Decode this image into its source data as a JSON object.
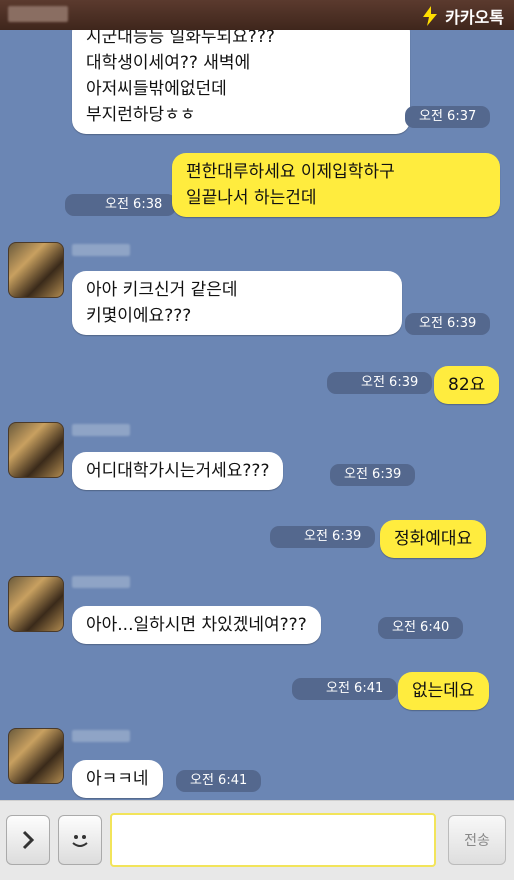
{
  "header": {
    "brand": "카카오톡"
  },
  "messages": [
    {
      "from": "them",
      "text": "시군대등등 일화두되요???\n대학생이세여?? 새벽에\n아저씨들밖에없던데\n부지런하당ㅎㅎ",
      "time": "오전 6:37"
    },
    {
      "from": "me",
      "text": "편한대루하세요 이제입학하구\n일끝나서 하는건데",
      "time": "오전 6:38"
    },
    {
      "from": "them",
      "text": "아아 키크신거 같은데\n키몇이에요???",
      "time": "오전 6:39"
    },
    {
      "from": "me",
      "text": "82요",
      "time": "오전 6:39"
    },
    {
      "from": "them",
      "text": "어디대학가시는거세요???",
      "time": "오전 6:39"
    },
    {
      "from": "me",
      "text": "정화예대요",
      "time": "오전 6:39"
    },
    {
      "from": "them",
      "text": "아아...일하시면 차있겠네여???",
      "time": "오전 6:40"
    },
    {
      "from": "me",
      "text": "없는데요",
      "time": "오전 6:41"
    },
    {
      "from": "them",
      "text": "아ㅋㅋ네",
      "time": "오전 6:41"
    }
  ],
  "composer": {
    "send_label": "전송",
    "expand_icon": "chevron-right-icon",
    "emoticon_icon": "smiley-icon"
  },
  "colors": {
    "background": "#6b86b4",
    "outgoing": "#ffec3e",
    "incoming": "#ffffff",
    "header": "#4b2f24"
  }
}
